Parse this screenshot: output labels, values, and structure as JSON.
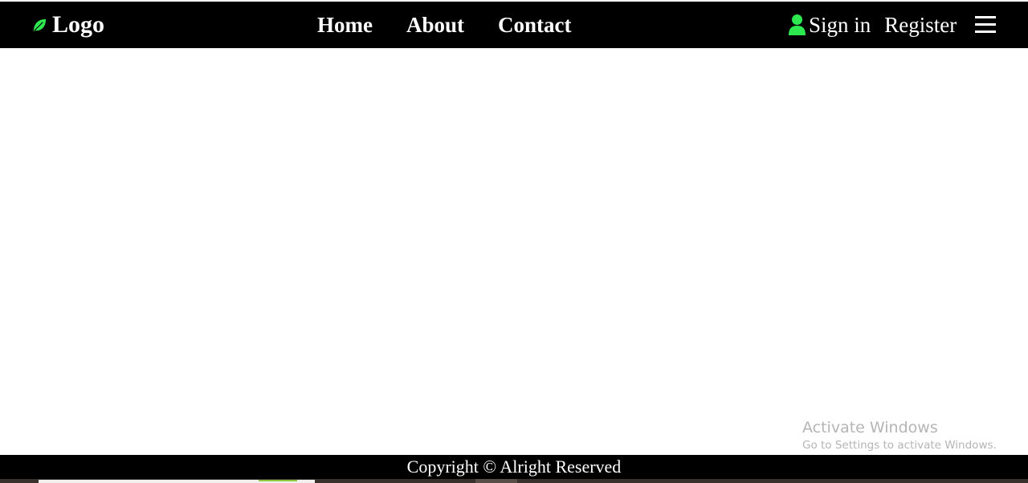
{
  "header": {
    "logo_text": "Logo",
    "logo_icon": "leaf-icon",
    "nav_links": [
      "Home",
      "About",
      "Contact"
    ],
    "sign_in_label": "Sign in",
    "sign_in_icon": "user-icon",
    "register_label": "Register",
    "menu_icon": "hamburger-menu-icon"
  },
  "watermark": {
    "title": "Activate Windows",
    "subtitle": "Go to Settings to activate Windows."
  },
  "footer": {
    "copyright": "Copyright © Alright Reserved"
  },
  "colors": {
    "navbar_bg": "#000000",
    "accent_green": "#2ee84f",
    "text": "#ffffff",
    "page_bg": "#ffffff"
  }
}
